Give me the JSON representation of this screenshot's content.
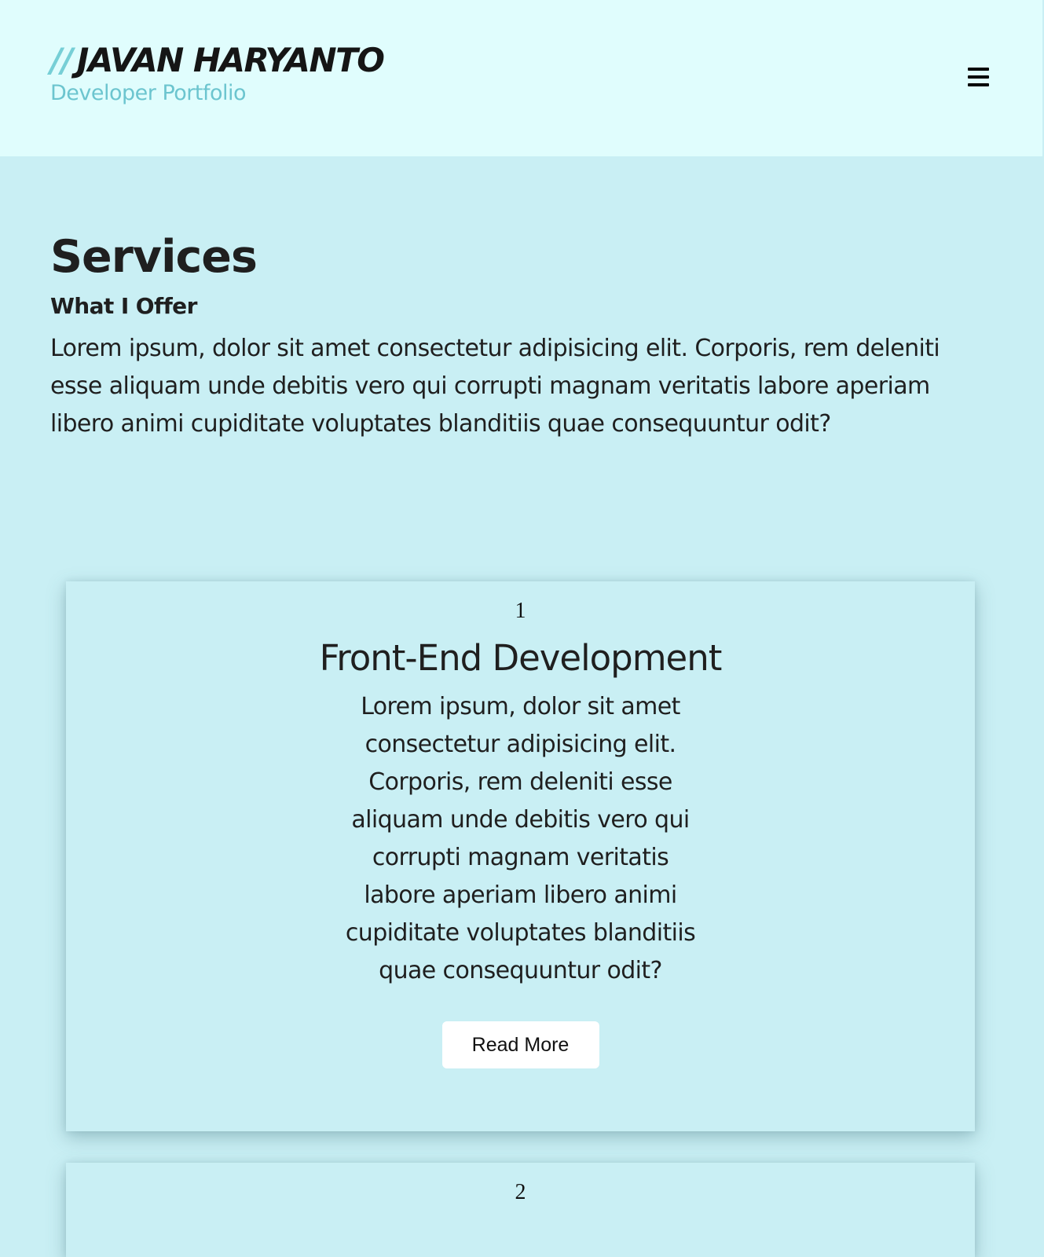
{
  "header": {
    "brand_slashes": "//",
    "brand_name": "JAVAN HARYANTO",
    "brand_subtitle": "Developer Portfolio",
    "menu_icon": "hamburger-menu-icon"
  },
  "services": {
    "title": "Services",
    "subtitle": "What I Offer",
    "intro": "Lorem ipsum, dolor sit amet consectetur adipisicing elit. Corporis, rem deleniti esse aliquam unde debitis vero qui corrupti magnam veritatis labore aperiam libero animi cupiditate voluptates blanditiis quae consequuntur odit?",
    "cards": [
      {
        "number": "1",
        "title": "Front-End Development",
        "text": "Lorem ipsum, dolor sit amet consectetur adipisicing elit. Corporis, rem deleniti esse aliquam unde debitis vero qui corrupti magnam veritatis labore aperiam libero animi cupiditate voluptates blanditiis quae consequuntur odit?",
        "button_label": "Read More"
      },
      {
        "number": "2"
      }
    ]
  },
  "colors": {
    "header_bg": "#e0fdfd",
    "page_bg": "#c9eff4",
    "accent": "#6cc5cf",
    "button_bg": "#ffffff"
  }
}
